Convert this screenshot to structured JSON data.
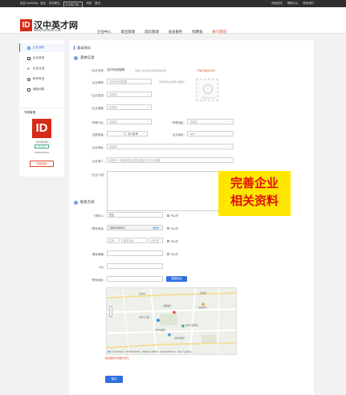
{
  "topbar": {
    "left": [
      "欢迎 hrv0916a，退出",
      "发布职位",
      "汉中英才网...",
      "消息",
      "退出"
    ],
    "right": [
      "网站首页",
      "帮助中心",
      "联系我们"
    ]
  },
  "header": {
    "logo_mark": "ID",
    "logo_name": "汉中英才网",
    "logo_url": "www.hv0916.com",
    "nav": [
      "企业中心",
      "职位管理",
      "简历管理",
      "会员服务",
      "招聘会",
      "帐号管理"
    ]
  },
  "sidebar": {
    "items": [
      "企业资料",
      "企业风采",
      "企业认证",
      "帐号安全",
      "我的消息"
    ],
    "section": "专属客服",
    "qr_logo": "ID",
    "contact_name": "汉中英才网",
    "contact_badge": "已认证",
    "contact_phone": "15309160612",
    "button": "在线咨询"
  },
  "main": {
    "crumb": "基本资料",
    "section_basic": "基本信息",
    "section_contact": "联系方式",
    "callout": [
      "完善企业",
      "相关资料"
    ]
  },
  "form": {
    "company_name": {
      "label": "企业名称：",
      "value": "汉中市测试招聘",
      "hint": "请输入企业营业执照完整名称",
      "hint_red": "（字段不超过30字）"
    },
    "short_name": {
      "label": "企业简称：",
      "placeholder": "汉中市测试招聘"
    },
    "short_hint": "请填写企业简称以便推广",
    "upload_caption": "上传企业LOGO",
    "nature": {
      "label": "企业性质：",
      "placeholder": "请选择"
    },
    "scale": {
      "label": "企业规模：",
      "placeholder": "请选择"
    },
    "industry": {
      "label": "所属行业：",
      "placeholder": "请选择"
    },
    "region": {
      "label": "所属地区：",
      "placeholder": "请选择"
    },
    "capital": {
      "label": "注册资金：",
      "unit": "万人民币"
    },
    "website": {
      "label": "企业网址：",
      "placeholder": "http://"
    },
    "address": {
      "label": "企业地址：",
      "placeholder": "请选择"
    },
    "tags": {
      "label": "企业简介：",
      "placeholder": "请填写一句话描述企业的主要业务与行业领域"
    },
    "intro": {
      "label": "企业介绍："
    },
    "contact_person": {
      "label": "联系人：",
      "value": "先生"
    },
    "phone": {
      "label": "联系电话：",
      "value": "15309160612",
      "action": "修改"
    },
    "tel_area": "区号",
    "tel_number": "座机电话",
    "tel_ext": "分机号",
    "email": {
      "label": "联系邮箱："
    },
    "qq": {
      "label": "QQ："
    },
    "location": {
      "label": "联系地址：",
      "button": "搜索地点"
    },
    "public": "不公开",
    "map_locate": "拖动图标在地图中定位",
    "save": "保存"
  },
  "map": {
    "places": [
      "汉中市",
      "汉台区",
      "中国银行",
      "汉中中学",
      "汉中石门路",
      "汉中人民医院",
      "汉中市政府",
      "汉中市政府"
    ],
    "credit": "© 2020 Baidu - GS(2019)5218号 - 甲测资字1100930 - 京ICP证030173号 - Data © 长地万方"
  }
}
